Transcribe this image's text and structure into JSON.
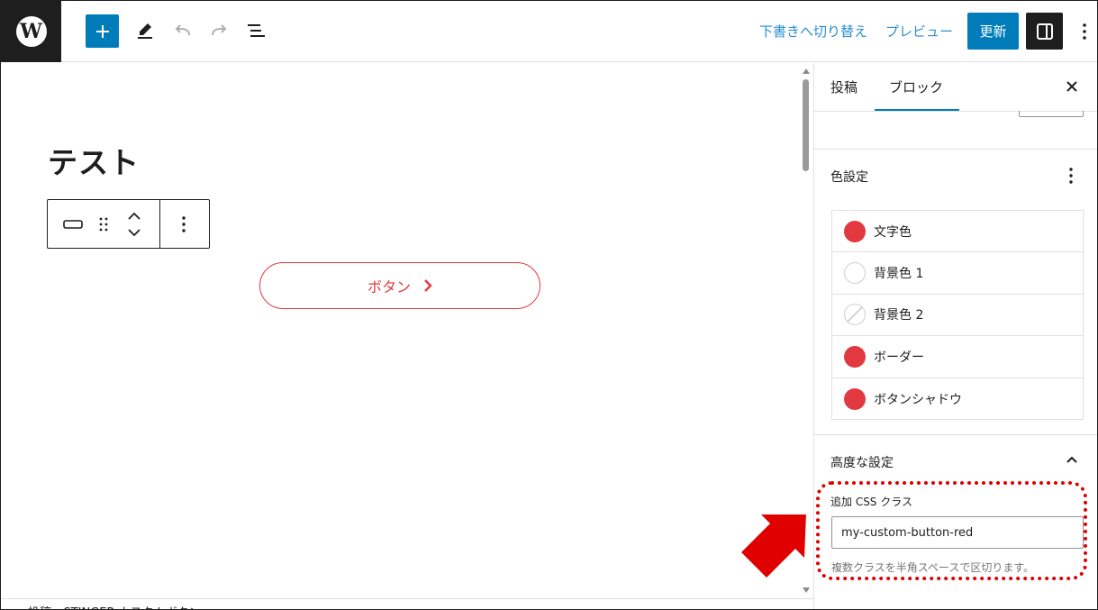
{
  "topbar": {
    "wp_logo_glyph": "W",
    "switch_to_draft": "下書きへ切り替え",
    "preview": "プレビュー",
    "update": "更新"
  },
  "editor": {
    "post_title": "テスト",
    "button_text": "ボタン",
    "footer_breadcrumb": "投稿 › STINGER カスタムボタン"
  },
  "sidebar": {
    "tabs": [
      {
        "label": "投稿",
        "active": false
      },
      {
        "label": "ブロック",
        "active": true
      }
    ],
    "color_panel": {
      "title": "色設定",
      "items": [
        {
          "label": "文字色",
          "swatch": "#e2383f"
        },
        {
          "label": "背景色 1",
          "swatch": "none"
        },
        {
          "label": "背景色 2",
          "swatch": "none"
        },
        {
          "label": "ボーダー",
          "swatch": "#e2383f"
        },
        {
          "label": "ボタンシャドウ",
          "swatch": "#e2383f"
        }
      ]
    },
    "advanced_panel": {
      "title": "高度な設定",
      "css_class_label": "追加 CSS クラス",
      "css_class_value": "my-custom-button-red",
      "css_class_help": "複数クラスを半角スペースで区切ります。"
    }
  },
  "colors": {
    "accent": "#007cba",
    "link": "#2a8fd1",
    "button_red": "#e2383f",
    "annotation_red": "#e00000"
  },
  "icons": {
    "undo": "undo-icon",
    "redo": "redo-icon",
    "edit": "pencil-icon",
    "list_view": "list-view-icon"
  }
}
